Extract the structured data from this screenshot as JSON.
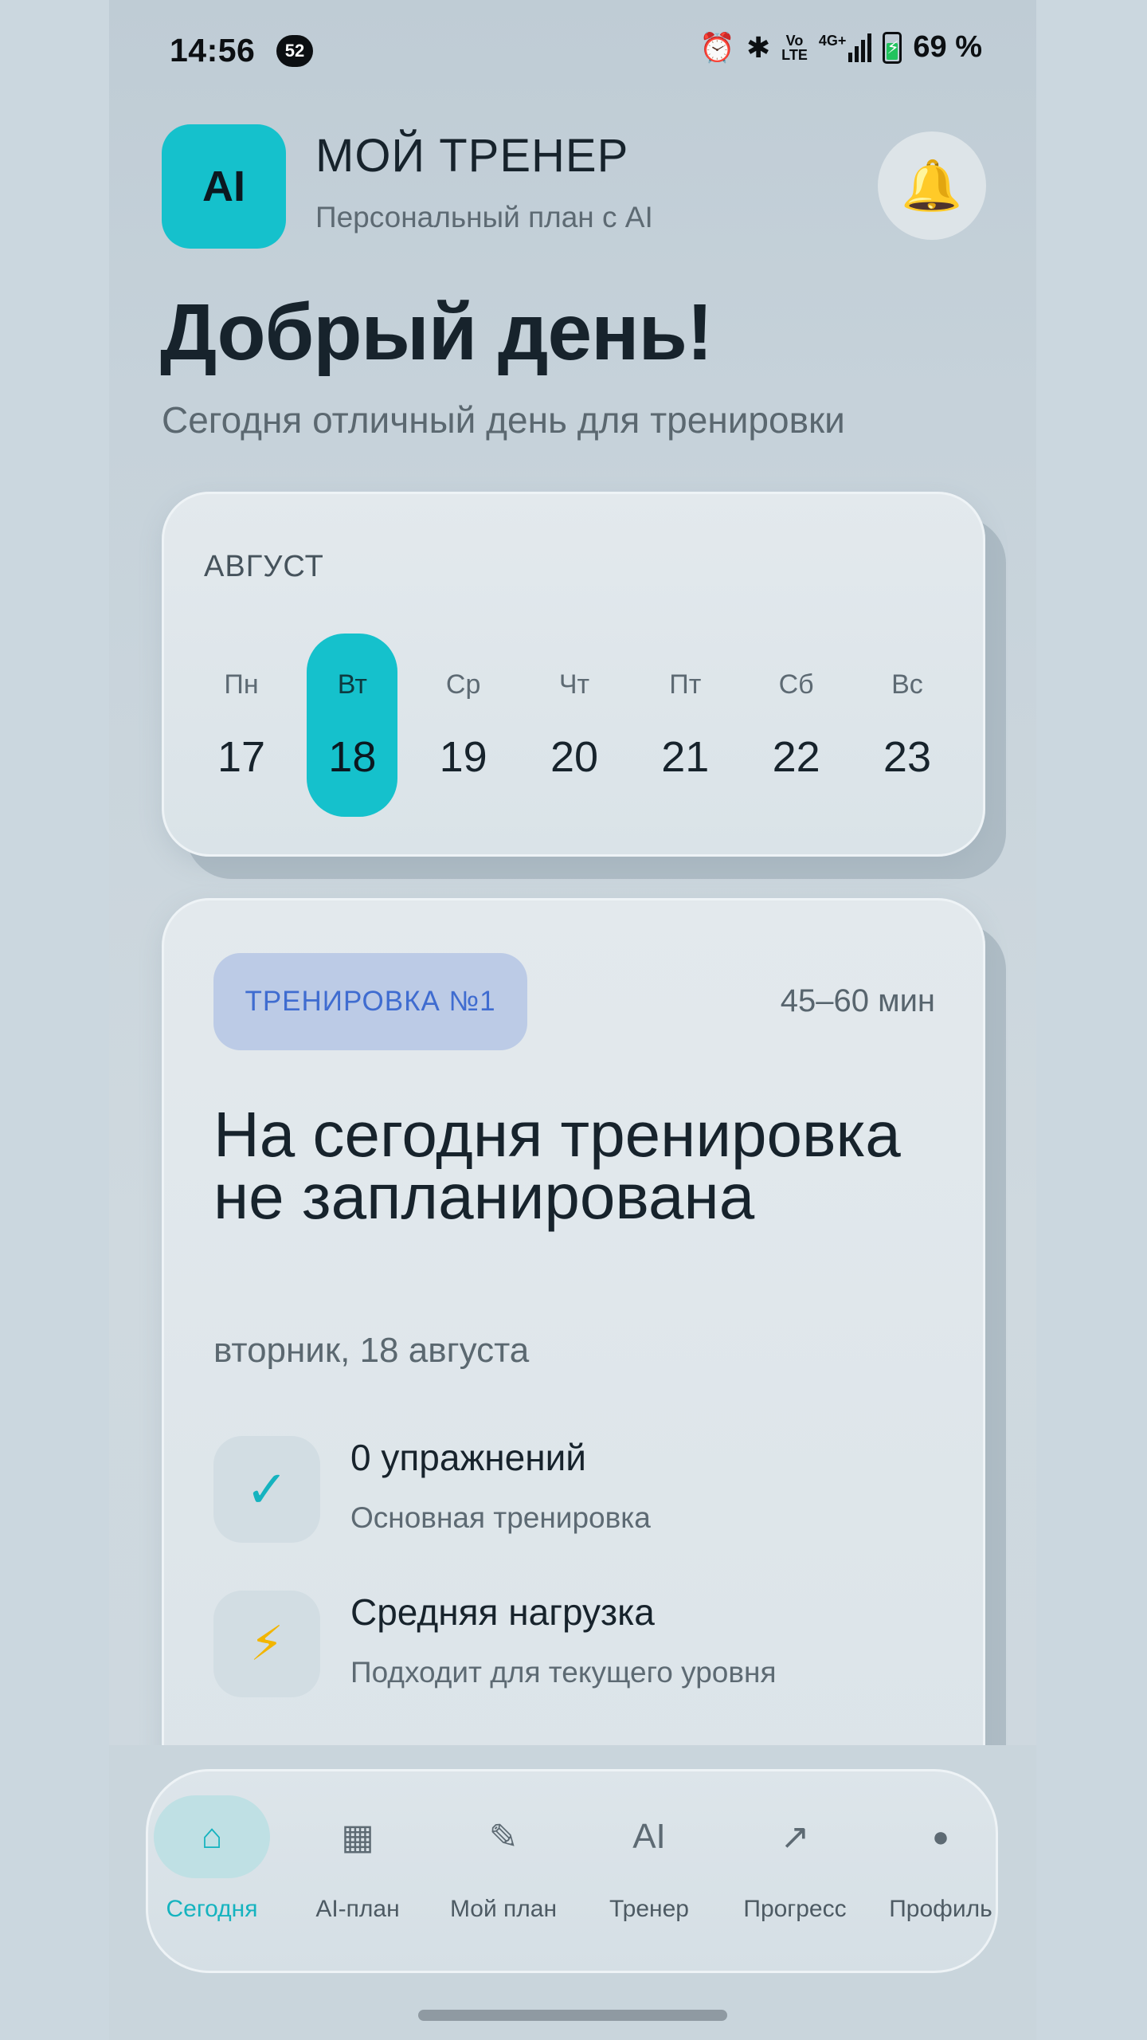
{
  "status_bar": {
    "time": "14:56",
    "notification_count": "52",
    "network": "4G+",
    "volte_top": "Vo",
    "volte_bottom": "LTE",
    "battery": "69 %",
    "battery_level": 0.69
  },
  "header": {
    "logo_text": "AI",
    "title": "МОЙ ТРЕНЕР",
    "subtitle": "Персональный план с AI"
  },
  "greeting": {
    "title": "Добрый день!",
    "subtitle": "Сегодня отличный день для тренировки"
  },
  "calendar": {
    "month": "АВГУСТ",
    "days": [
      {
        "name": "Пн",
        "date": "17"
      },
      {
        "name": "Вт",
        "date": "18"
      },
      {
        "name": "Ср",
        "date": "19"
      },
      {
        "name": "Чт",
        "date": "20"
      },
      {
        "name": "Пт",
        "date": "21"
      },
      {
        "name": "Сб",
        "date": "22"
      },
      {
        "name": "Вс",
        "date": "23"
      }
    ],
    "selected_index": 1
  },
  "workout": {
    "badge": "ТРЕНИРОВКА №1",
    "duration": "45–60 мин",
    "title": "На сегодня тренировка не запланирована",
    "date": "вторник, 18 августа",
    "features": [
      {
        "icon": "check-icon",
        "glyph": "✓",
        "title": "0 упражнений",
        "subtitle": "Основная тренировка"
      },
      {
        "icon": "lightning-icon",
        "glyph": "⚡",
        "title": "Средняя нагрузка",
        "subtitle": "Подходит для текущего уровня"
      }
    ]
  },
  "nav": {
    "items": [
      {
        "label": "Сегодня",
        "glyph": "⌂",
        "icon": "home-icon"
      },
      {
        "label": "AI-план",
        "glyph": "▦",
        "icon": "grid-icon"
      },
      {
        "label": "Мой план",
        "glyph": "✎",
        "icon": "pencil-icon"
      },
      {
        "label": "Тренер",
        "glyph": "AI",
        "icon": "ai-icon"
      },
      {
        "label": "Прогресс",
        "glyph": "↗",
        "icon": "arrow-up-right-icon"
      },
      {
        "label": "Профиль",
        "glyph": "●",
        "icon": "dot-icon"
      }
    ],
    "active_index": 0
  },
  "colors": {
    "accent": "#15c1cc",
    "badge_bg": "#bccbe6",
    "badge_text": "#3f6cd0",
    "text_primary": "#17232c"
  }
}
